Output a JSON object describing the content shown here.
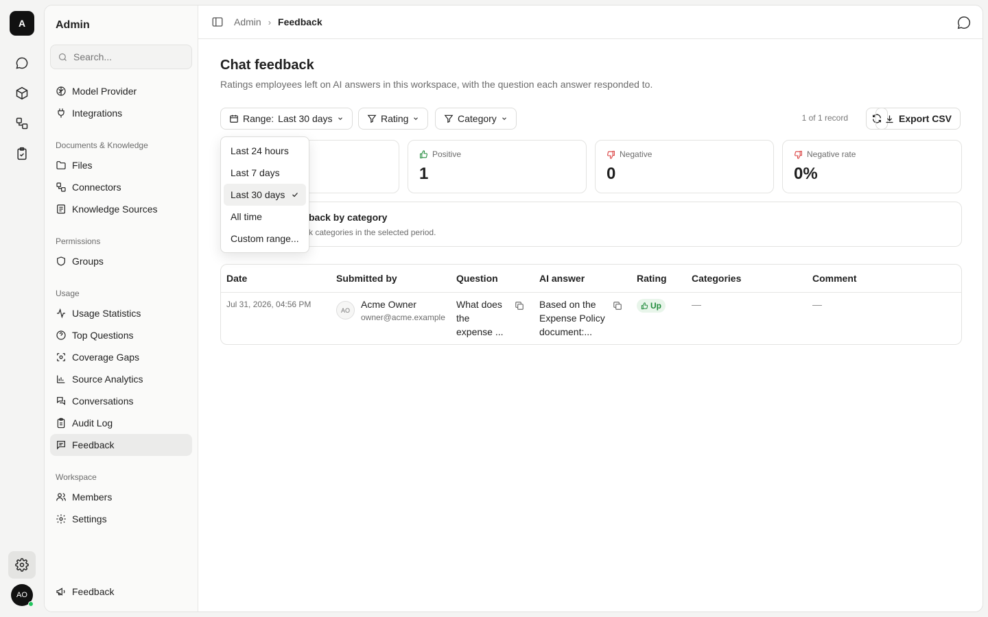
{
  "rail": {
    "logo": "A",
    "avatar": "AO"
  },
  "sidebar": {
    "title": "Admin",
    "search_placeholder": "Search...",
    "top_items": [
      {
        "label": "Model Provider",
        "icon": "brain-icon"
      },
      {
        "label": "Integrations",
        "icon": "plug-icon"
      }
    ],
    "sections": [
      {
        "title": "Documents & Knowledge",
        "items": [
          "Files",
          "Connectors",
          "Knowledge Sources"
        ]
      },
      {
        "title": "Permissions",
        "items": [
          "Groups"
        ]
      },
      {
        "title": "Usage",
        "items": [
          "Usage Statistics",
          "Top Questions",
          "Coverage Gaps",
          "Source Analytics",
          "Conversations",
          "Audit Log",
          "Feedback"
        ]
      },
      {
        "title": "Workspace",
        "items": [
          "Members",
          "Settings"
        ]
      }
    ],
    "bottom_item": "Feedback"
  },
  "breadcrumb": {
    "parent": "Admin",
    "current": "Feedback"
  },
  "page": {
    "title": "Chat feedback",
    "subtitle": "Ratings employees left on AI answers in this workspace, with the question each answer responded to."
  },
  "filters": {
    "range_label": "Range:",
    "range_value": "Last 30 days",
    "rating": "Rating",
    "category": "Category",
    "count": "1 of 1 record",
    "export": "Export CSV"
  },
  "stats": [
    {
      "label": "Positive",
      "value": "1"
    },
    {
      "label": "Negative",
      "value": "0"
    },
    {
      "label": "Negative rate",
      "value": "0%"
    }
  ],
  "category_box": {
    "title": "back by category",
    "desc": "k categories in the selected period."
  },
  "table": {
    "headers": [
      "Date",
      "Submitted by",
      "Question",
      "AI answer",
      "Rating",
      "Categories",
      "Comment"
    ],
    "row": {
      "date": "Jul 31, 2026, 04:56 PM",
      "avatar": "AO",
      "name": "Acme Owner",
      "email": "owner@acme.example",
      "question": [
        "What does",
        "the",
        "expense ..."
      ],
      "answer": [
        "Based on the",
        "Expense Policy",
        "document:..."
      ],
      "rating": "Up",
      "categories": "—",
      "comment": "—"
    }
  },
  "dropdown": {
    "options": [
      "Last 24 hours",
      "Last 7 days",
      "Last 30 days",
      "All time",
      "Custom range..."
    ],
    "selected": "Last 30 days"
  },
  "colors": {
    "positive": "#1f8a3a",
    "negative": "#d93b3b",
    "accent": "#111111"
  }
}
